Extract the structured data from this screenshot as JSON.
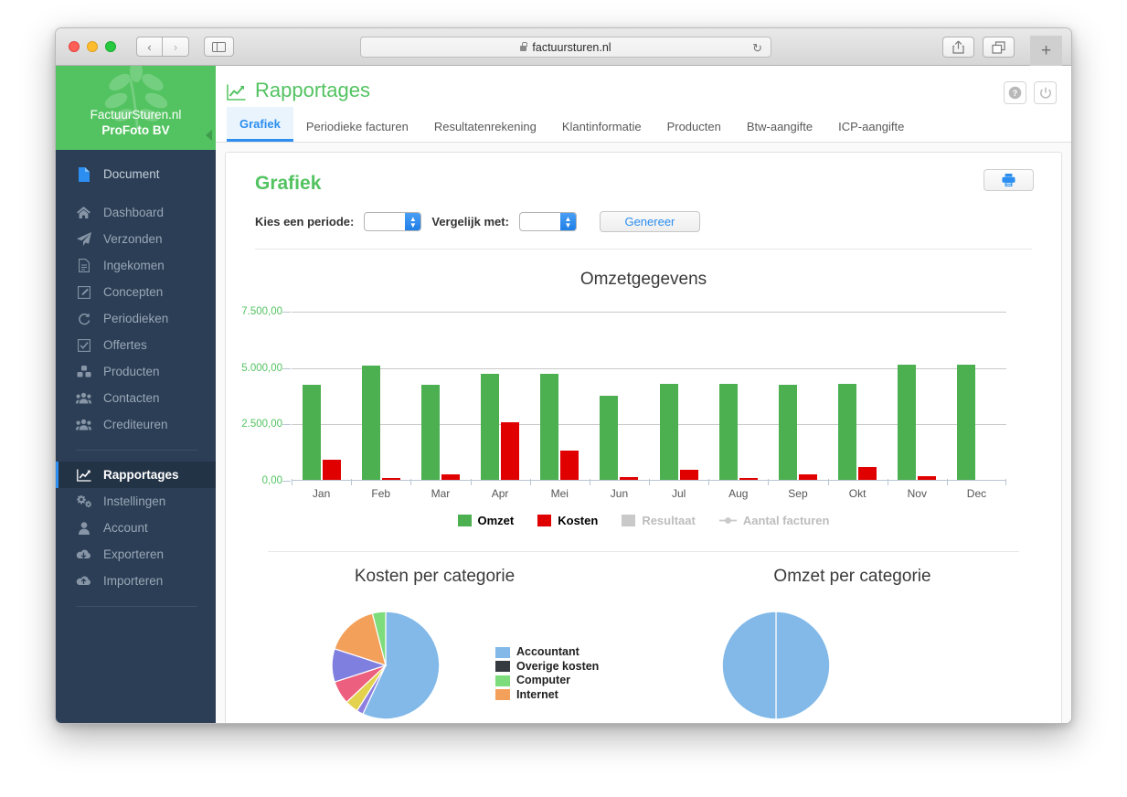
{
  "browser": {
    "url": "factuursturen.nl",
    "back_label": "‹",
    "forward_label": "›",
    "reload_label": "↻",
    "newtab_label": "+"
  },
  "sidebar": {
    "brand_name": "FactuurSturen.nl",
    "brand_sub": "ProFoto BV",
    "items": [
      {
        "label": "Document",
        "icon": "document-icon",
        "active": false
      },
      {
        "label": "Dashboard",
        "icon": "home-icon",
        "active": false
      },
      {
        "label": "Verzonden",
        "icon": "paper-plane-icon",
        "active": false
      },
      {
        "label": "Ingekomen",
        "icon": "file-icon",
        "active": false
      },
      {
        "label": "Concepten",
        "icon": "edit-icon",
        "active": false
      },
      {
        "label": "Periodieken",
        "icon": "refresh-icon",
        "active": false
      },
      {
        "label": "Offertes",
        "icon": "check-square-icon",
        "active": false
      },
      {
        "label": "Producten",
        "icon": "cubes-icon",
        "active": false
      },
      {
        "label": "Contacten",
        "icon": "users-icon",
        "active": false
      },
      {
        "label": "Crediteuren",
        "icon": "users-icon",
        "active": false
      },
      {
        "label": "Rapportages",
        "icon": "chart-line-icon",
        "active": true
      },
      {
        "label": "Instellingen",
        "icon": "gears-icon",
        "active": false
      },
      {
        "label": "Account",
        "icon": "user-icon",
        "active": false
      },
      {
        "label": "Exporteren",
        "icon": "cloud-download-icon",
        "active": false
      },
      {
        "label": "Importeren",
        "icon": "cloud-upload-icon",
        "active": false
      }
    ]
  },
  "header": {
    "title": "Rapportages",
    "help_label": "?",
    "power_label": "⏻"
  },
  "tabs": [
    {
      "label": "Grafiek",
      "active": true
    },
    {
      "label": "Periodieke facturen",
      "active": false
    },
    {
      "label": "Resultatenrekening",
      "active": false
    },
    {
      "label": "Klantinformatie",
      "active": false
    },
    {
      "label": "Producten",
      "active": false
    },
    {
      "label": "Btw-aangifte",
      "active": false
    },
    {
      "label": "ICP-aangifte",
      "active": false
    }
  ],
  "panel": {
    "title": "Grafiek",
    "period_label": "Kies een periode:",
    "period_value": "",
    "compare_label": "Vergelijk met:",
    "compare_value": "",
    "generate_label": "Genereer"
  },
  "colors": {
    "brand_green": "#53c361",
    "bar_omzet": "#4caf50",
    "bar_kosten": "#e00000",
    "accent_blue": "#2b8ef0",
    "sidebar_bg": "#2b3e55"
  },
  "chart_data": [
    {
      "type": "bar",
      "title": "Omzetgegevens",
      "xlabel": "",
      "ylabel": "",
      "ylim": [
        0,
        7500
      ],
      "yticks": [
        0,
        2500,
        5000,
        7500
      ],
      "ytick_labels": [
        "0,00",
        "2.500,00",
        "5.000,00",
        "7.500,00"
      ],
      "grid": true,
      "legend_position": "bottom",
      "categories": [
        "Jan",
        "Feb",
        "Mar",
        "Apr",
        "Mei",
        "Jun",
        "Jul",
        "Aug",
        "Sep",
        "Okt",
        "Nov",
        "Dec"
      ],
      "series": [
        {
          "name": "Omzet",
          "color": "#4caf50",
          "enabled": true,
          "values": [
            4200,
            5050,
            4200,
            4700,
            4700,
            3750,
            4250,
            4250,
            4200,
            4250,
            5100,
            5100
          ]
        },
        {
          "name": "Kosten",
          "color": "#e00000",
          "enabled": true,
          "values": [
            900,
            90,
            260,
            2550,
            1300,
            110,
            450,
            80,
            240,
            550,
            170,
            0
          ]
        },
        {
          "name": "Resultaat",
          "color": "#c9c9c9",
          "enabled": false,
          "values": []
        },
        {
          "name": "Aantal facturen",
          "color": "#c9c9c9",
          "enabled": false,
          "values": []
        }
      ]
    },
    {
      "type": "pie",
      "title": "Kosten per categorie",
      "legend_position": "right",
      "labels": [
        "Accountant",
        "Overige kosten",
        "Computer",
        "Internet"
      ],
      "slices": [
        {
          "label": "Accountant",
          "color": "#82b9e8",
          "value": 57
        },
        {
          "label": "Overige kosten",
          "color": "#8d7ee0",
          "value": 2
        },
        {
          "label": "Computer",
          "color": "#e3d24e",
          "value": 4
        },
        {
          "label": "Internet",
          "color": "#ed5f7e",
          "value": 7
        },
        {
          "label": "Overige kosten",
          "color": "#7f7fe0",
          "value": 10
        },
        {
          "label": "Internet",
          "color": "#f3a05a",
          "value": 16
        },
        {
          "label": "Computer",
          "color": "#7ddc7b",
          "value": 4
        }
      ]
    },
    {
      "type": "pie",
      "title": "Omzet per categorie",
      "legend_position": "right",
      "labels": [],
      "slices": [
        {
          "label": "",
          "color": "#82b9e8",
          "value": 50
        },
        {
          "label": "",
          "color": "#82b9e8",
          "value": 50
        }
      ]
    }
  ],
  "pie_legend": [
    {
      "label": "Accountant",
      "color": "#82b9e8"
    },
    {
      "label": "Overige kosten",
      "color": "#343a40"
    },
    {
      "label": "Computer",
      "color": "#7ddc7b"
    },
    {
      "label": "Internet",
      "color": "#f3a05a"
    }
  ]
}
